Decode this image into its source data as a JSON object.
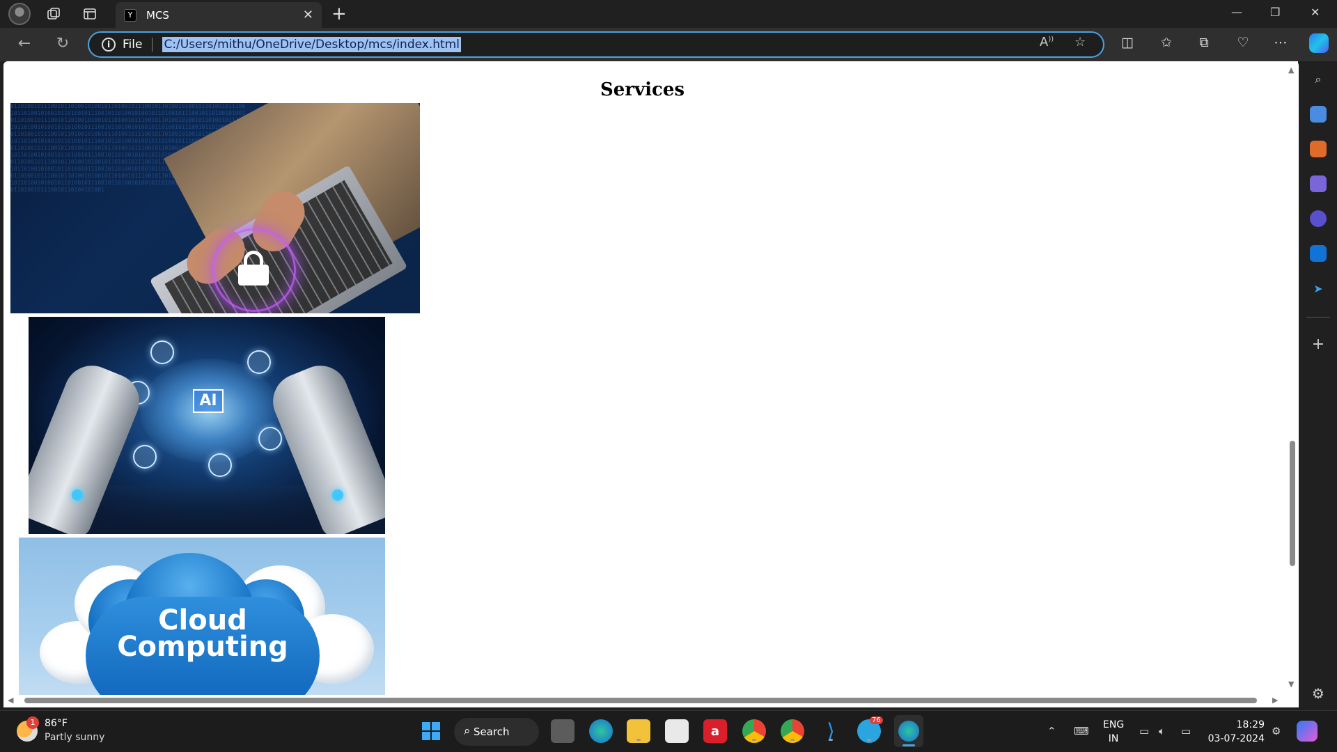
{
  "browser": {
    "tab_title": "MCS",
    "tab_favicon_letter": "Y",
    "address_scheme": "File",
    "address_url": "C:/Users/mithu/OneDrive/Desktop/mcs/index.html"
  },
  "page": {
    "heading": "Services",
    "images": [
      {
        "name": "cybersecurity-image",
        "icon": "lock-icon"
      },
      {
        "name": "ai-robot-hands-image",
        "label": "AI"
      },
      {
        "name": "cloud-computing-image",
        "line1": "Cloud",
        "line2": "Computing"
      }
    ]
  },
  "taskbar": {
    "weather_temp": "86°F",
    "weather_desc": "Partly sunny",
    "weather_badge": "1",
    "search_label": "Search",
    "telegram_badge": "76",
    "lang_line1": "ENG",
    "lang_line2": "IN",
    "time": "18:29",
    "date": "03-07-2024"
  },
  "colors": {
    "accent": "#4aa2e0",
    "url_highlight": "#9fc3f0",
    "cloud_blue": "#1473c6",
    "sky": "#a8cfee"
  }
}
